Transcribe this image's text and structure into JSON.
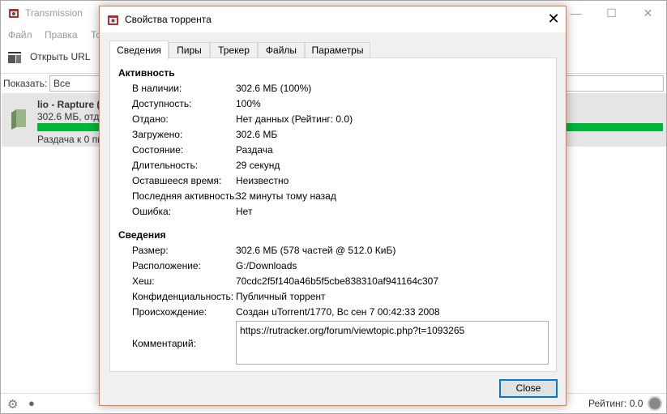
{
  "main_window": {
    "title": "Transmission",
    "menu": [
      "Файл",
      "Правка",
      "То"
    ],
    "toolbar": {
      "open_url": "Открыть URL"
    },
    "filter": {
      "label": "Показать:",
      "value": "Все"
    },
    "torrent": {
      "name": "lio - Rapture (",
      "info": "302.6 МБ, отда",
      "progress": 100,
      "status": "Раздача к 0 пи"
    },
    "statusbar": {
      "ratio": "Рейтинг: 0.0"
    }
  },
  "dialog": {
    "title": "Свойства торрента",
    "tabs": [
      "Сведения",
      "Пиры",
      "Трекер",
      "Файлы",
      "Параметры"
    ],
    "active_tab": "Сведения",
    "activity": {
      "title": "Активность",
      "rows": [
        {
          "label": "В наличии:",
          "value": "302.6 МБ (100%)"
        },
        {
          "label": "Доступность:",
          "value": "100%"
        },
        {
          "label": "Отдано:",
          "value": "Нет данных (Рейтинг: 0.0)"
        },
        {
          "label": "Загружено:",
          "value": "302.6 МБ"
        },
        {
          "label": "Состояние:",
          "value": "Раздача"
        },
        {
          "label": "Длительность:",
          "value": "29 секунд"
        },
        {
          "label": "Оставшееся время:",
          "value": "Неизвестно"
        },
        {
          "label": "Последняя активность:",
          "value": "32 минуты тому назад"
        },
        {
          "label": "Ошибка:",
          "value": "Нет"
        }
      ]
    },
    "details": {
      "title": "Сведения",
      "rows": [
        {
          "label": "Размер:",
          "value": "302.6 МБ (578 частей @ 512.0 КиБ)"
        },
        {
          "label": "Расположение:",
          "value": "G:/Downloads"
        },
        {
          "label": "Хеш:",
          "value": "70cdc2f5f140a46b5f5cbe838310af941164c307"
        },
        {
          "label": "Конфиденциальность:",
          "value": "Публичный торрент"
        },
        {
          "label": "Происхождение:",
          "value": "Создан uTorrent/1770, Вс сен 7 00:42:33 2008"
        }
      ],
      "comment_label": "Комментарий:",
      "comment_value": "https://rutracker.org/forum/viewtopic.php?t=1093265"
    },
    "close_label": "Close"
  },
  "colors": {
    "progress": "#00b43c",
    "dialog_border": "#e57d43",
    "focus": "#0078d7"
  }
}
